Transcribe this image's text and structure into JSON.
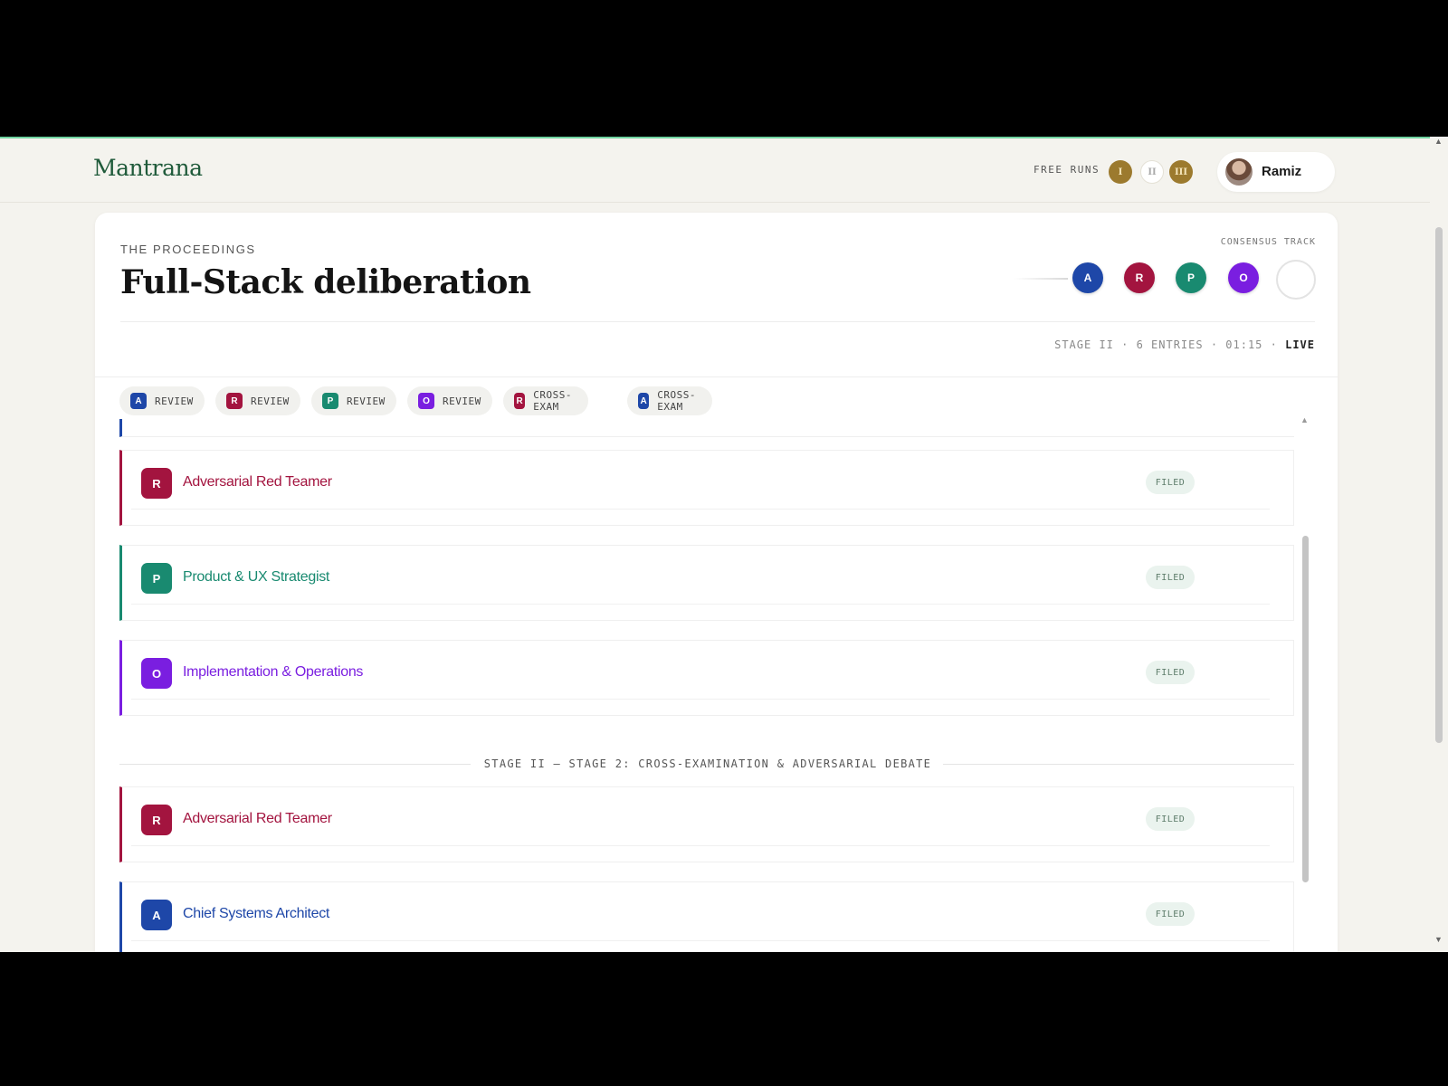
{
  "header": {
    "logo": "Mantrana",
    "free_runs_label": "FREE RUNS",
    "coins": [
      {
        "label": "I",
        "state": "used"
      },
      {
        "label": "II",
        "state": "available"
      },
      {
        "label": "III",
        "state": "used"
      }
    ],
    "user_name": "Ramiz"
  },
  "proceedings": {
    "eyebrow": "THE PROCEEDINGS",
    "title": "Full-Stack deliberation",
    "consensus_label": "CONSENSUS TRACK",
    "track": [
      {
        "letter": "A",
        "color": "#1e47a8"
      },
      {
        "letter": "R",
        "color": "#a3143f"
      },
      {
        "letter": "P",
        "color": "#198a70"
      },
      {
        "letter": "O",
        "color": "#7a1ee0"
      },
      {
        "letter": "",
        "color": "#ffffff"
      }
    ],
    "stage_meta": "STAGE II · 6 ENTRIES · 01:15 ·",
    "live_label": "LIVE"
  },
  "chips": [
    {
      "letter": "A",
      "label": "REVIEW",
      "color": "#1e47a8"
    },
    {
      "letter": "R",
      "label": "REVIEW",
      "color": "#a3143f"
    },
    {
      "letter": "P",
      "label": "REVIEW",
      "color": "#198a70"
    },
    {
      "letter": "O",
      "label": "REVIEW",
      "color": "#7a1ee0"
    },
    {
      "letter": "R",
      "label": "CROSS-EXAM",
      "color": "#a3143f"
    },
    {
      "letter": "A",
      "label": "CROSS-EXAM",
      "color": "#1e47a8"
    }
  ],
  "entries": [
    {
      "letter": "R",
      "name": "Adversarial Red Teamer",
      "status": "FILED",
      "color": "#a3143f"
    },
    {
      "letter": "P",
      "name": "Product & UX Strategist",
      "status": "FILED",
      "color": "#198a70"
    },
    {
      "letter": "O",
      "name": "Implementation & Operations",
      "status": "FILED",
      "color": "#7a1ee0"
    },
    {
      "letter": "R",
      "name": "Adversarial Red Teamer",
      "status": "FILED",
      "color": "#a3143f"
    },
    {
      "letter": "A",
      "name": "Chief Systems Architect",
      "status": "FILED",
      "color": "#1e47a8"
    }
  ],
  "stage_separator": "STAGE II — STAGE 2: CROSS-EXAMINATION & ADVERSARIAL DEBATE"
}
